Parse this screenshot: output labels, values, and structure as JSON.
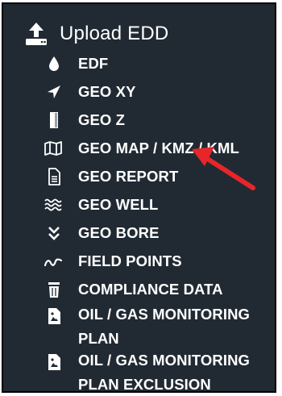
{
  "menu": {
    "header": {
      "label": "Upload EDD",
      "icon": "upload-icon"
    },
    "items": [
      {
        "label": "EDF",
        "icon": "drop-icon"
      },
      {
        "label": "GEO XY",
        "icon": "location-arrow-icon"
      },
      {
        "label": "GEO Z",
        "icon": "vertical-bar-icon"
      },
      {
        "label": "GEO MAP / KMZ / KML",
        "icon": "map-icon"
      },
      {
        "label": "GEO REPORT",
        "icon": "document-icon"
      },
      {
        "label": "GEO WELL",
        "icon": "water-waves-icon"
      },
      {
        "label": "GEO BORE",
        "icon": "double-chevron-down-icon"
      },
      {
        "label": "FIELD POINTS",
        "icon": "squiggle-icon"
      },
      {
        "label": "COMPLIANCE DATA",
        "icon": "trash-icon"
      },
      {
        "label_line1": "OIL / GAS MONITORING",
        "label_line2": "PLAN",
        "icon": "image-file-icon"
      },
      {
        "label_line1": "OIL / GAS MONITORING",
        "label_line2": "PLAN EXCLUSION",
        "icon": "image-file-icon"
      }
    ]
  },
  "colors": {
    "background": "#212a33",
    "text": "#ffffff",
    "arrow": "#e8262a",
    "border": "#000000"
  }
}
